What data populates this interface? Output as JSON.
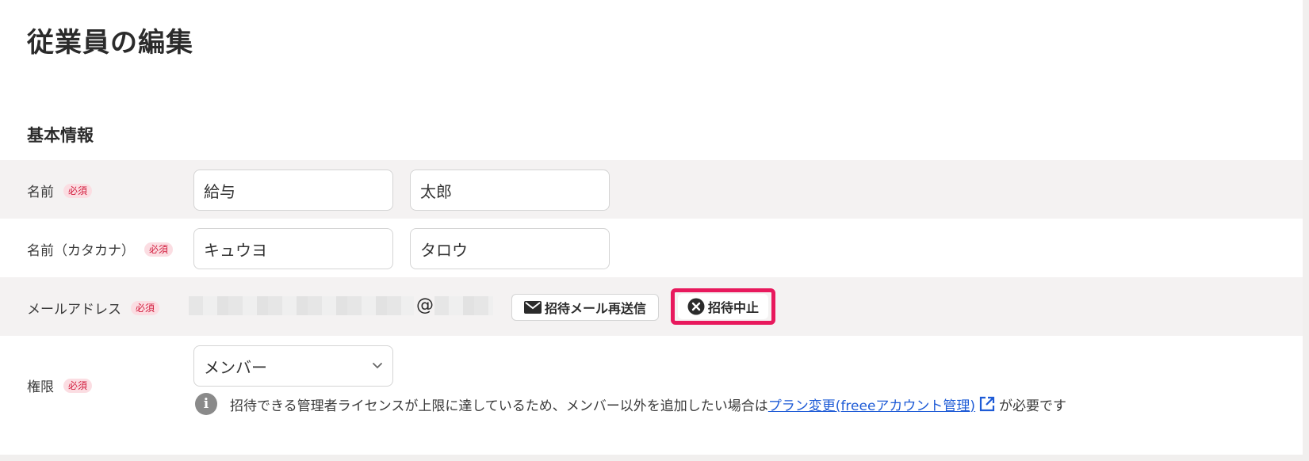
{
  "page": {
    "title": "従業員の編集"
  },
  "section": {
    "title": "基本情報"
  },
  "required_badge": "必須",
  "fields": {
    "name": {
      "label": "名前",
      "last_name": "給与",
      "first_name": "太郎"
    },
    "kana": {
      "label": "名前（カタカナ）",
      "last_name": "キュウヨ",
      "first_name": "タロウ"
    },
    "email": {
      "label": "メールアドレス",
      "at": "@",
      "resend_button": "招待メール再送信",
      "cancel_button": "招待中止"
    },
    "role": {
      "label": "権限",
      "selected": "メンバー"
    }
  },
  "notice": {
    "info_glyph": "i",
    "text_before": "招待できる管理者ライセンスが上限に達しているため、メンバー以外を追加したい場合は",
    "link_text": "プラン変更(freeeアカウント管理)",
    "text_after": "が必要です"
  },
  "colors": {
    "required_badge_bg": "#fbdde2",
    "required_badge_text": "#d21c3d",
    "highlight": "#e8195d",
    "link": "#1e5bd6"
  },
  "icons": [
    "mail-icon",
    "close-circle-icon",
    "chevron-down-icon",
    "info-icon",
    "external-link-icon"
  ]
}
